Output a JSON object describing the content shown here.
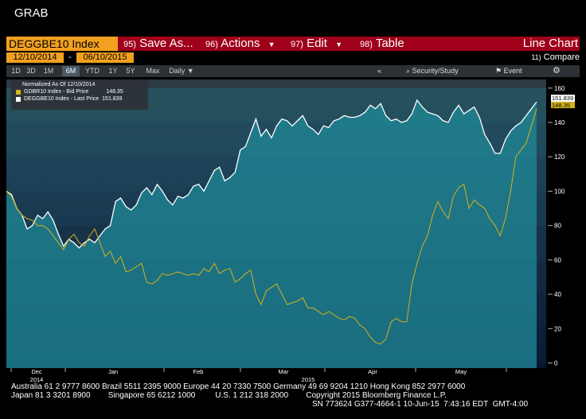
{
  "window": {
    "title": "GRAB"
  },
  "toolbar": {
    "ticker": "DEGGBE10 Index",
    "menu": [
      {
        "num": "95)",
        "label": "Save As..."
      },
      {
        "num": "96)",
        "label": "Actions"
      },
      {
        "num": "97)",
        "label": "Edit"
      },
      {
        "num": "98)",
        "label": "Table"
      }
    ],
    "view_label": "Line Chart"
  },
  "dates": {
    "start": "12/10/2014",
    "sep": "-",
    "end": "06/10/2015"
  },
  "compare": {
    "num": "11)",
    "label": "Compare"
  },
  "ranges": [
    "1D",
    "3D",
    "1M",
    "6M",
    "YTD",
    "1Y",
    "5Y",
    "Max"
  ],
  "selected_range": "6M",
  "frequency": "Daily",
  "tools": {
    "collapse": "«",
    "security_study": "Security/Study",
    "event": "Event"
  },
  "legend": {
    "header": "Normalized As Of 12/10/2014",
    "items": [
      {
        "label": "GDBR10 Index - Bid Price",
        "value": "148.35",
        "color": "#d4b21a"
      },
      {
        "label": "DEGGBE10 Index - Last Price",
        "value": "151.839",
        "color": "#ffffff"
      }
    ]
  },
  "chart_data": {
    "type": "line",
    "y_ticks": [
      0,
      20,
      40,
      60,
      80,
      100,
      120,
      140,
      160
    ],
    "ylim": [
      -3,
      165
    ],
    "x_months": [
      "Dec",
      "Jan",
      "Feb",
      "Mar",
      "Apr",
      "May"
    ],
    "x_years": [
      "2014",
      "2015"
    ],
    "last_labels": [
      "151.839",
      "148.35"
    ],
    "series": [
      {
        "name": "DEGGBE10 Index - Last Price",
        "color": "#ffffff",
        "values": [
          100,
          98,
          90,
          86,
          78,
          80,
          86,
          84,
          88,
          83,
          75,
          68,
          72,
          70,
          67,
          70,
          72,
          70,
          74,
          78,
          80,
          94,
          96,
          91,
          89,
          92,
          99,
          102,
          98,
          104,
          100,
          95,
          92,
          97,
          96,
          98,
          103,
          104,
          100,
          106,
          112,
          114,
          106,
          108,
          111,
          124,
          126,
          134,
          142,
          132,
          136,
          131,
          138,
          142,
          141,
          138,
          141,
          144,
          138,
          136,
          133,
          138,
          137,
          141,
          142,
          144,
          143,
          143,
          144,
          146,
          150,
          148,
          151,
          144,
          141,
          142,
          140,
          141,
          145,
          153,
          149,
          146,
          145,
          144,
          141,
          140,
          146,
          150,
          145,
          147,
          149,
          143,
          133,
          128,
          122,
          122,
          130,
          135,
          138,
          140,
          144,
          148,
          152
        ]
      },
      {
        "name": "GDBR10 Index - Bid Price",
        "color": "#d4b21a",
        "values": [
          100,
          97,
          90,
          86,
          84,
          83,
          80,
          80,
          78,
          74,
          70,
          66,
          72,
          75,
          70,
          68,
          74,
          78,
          70,
          62,
          65,
          58,
          62,
          53,
          54,
          56,
          58,
          47,
          46,
          48,
          52,
          51,
          52,
          53,
          52,
          51,
          52,
          51,
          55,
          53,
          58,
          52,
          54,
          55,
          47,
          49,
          52,
          54,
          40,
          34,
          42,
          44,
          46,
          40,
          34,
          35,
          36,
          38,
          32,
          32,
          30,
          28,
          30,
          28,
          26,
          25,
          27,
          26,
          22,
          20,
          15,
          12,
          11,
          14,
          24,
          26,
          24,
          24,
          46,
          58,
          68,
          74,
          86,
          94,
          88,
          84,
          97,
          102,
          104,
          90,
          95,
          92,
          90,
          84,
          80,
          74,
          84,
          100,
          120,
          124,
          128,
          138,
          148
        ]
      }
    ]
  },
  "footer": {
    "line1": "Australia 61 2 9777 8600 Brazil 5511 2395 9000 Europe 44 20 7330 7500 Germany 49 69 9204 1210 Hong Kong 852 2977 6000",
    "line2": "Japan 81 3 3201 8900        Singapore 65 6212 1000         U.S. 1 212 318 2000        Copyright 2015 Bloomberg Finance L.P.",
    "line3": "SN 773624 G377-4664-1 10-Jun-15  7:43:16 EDT  GMT-4:00"
  }
}
